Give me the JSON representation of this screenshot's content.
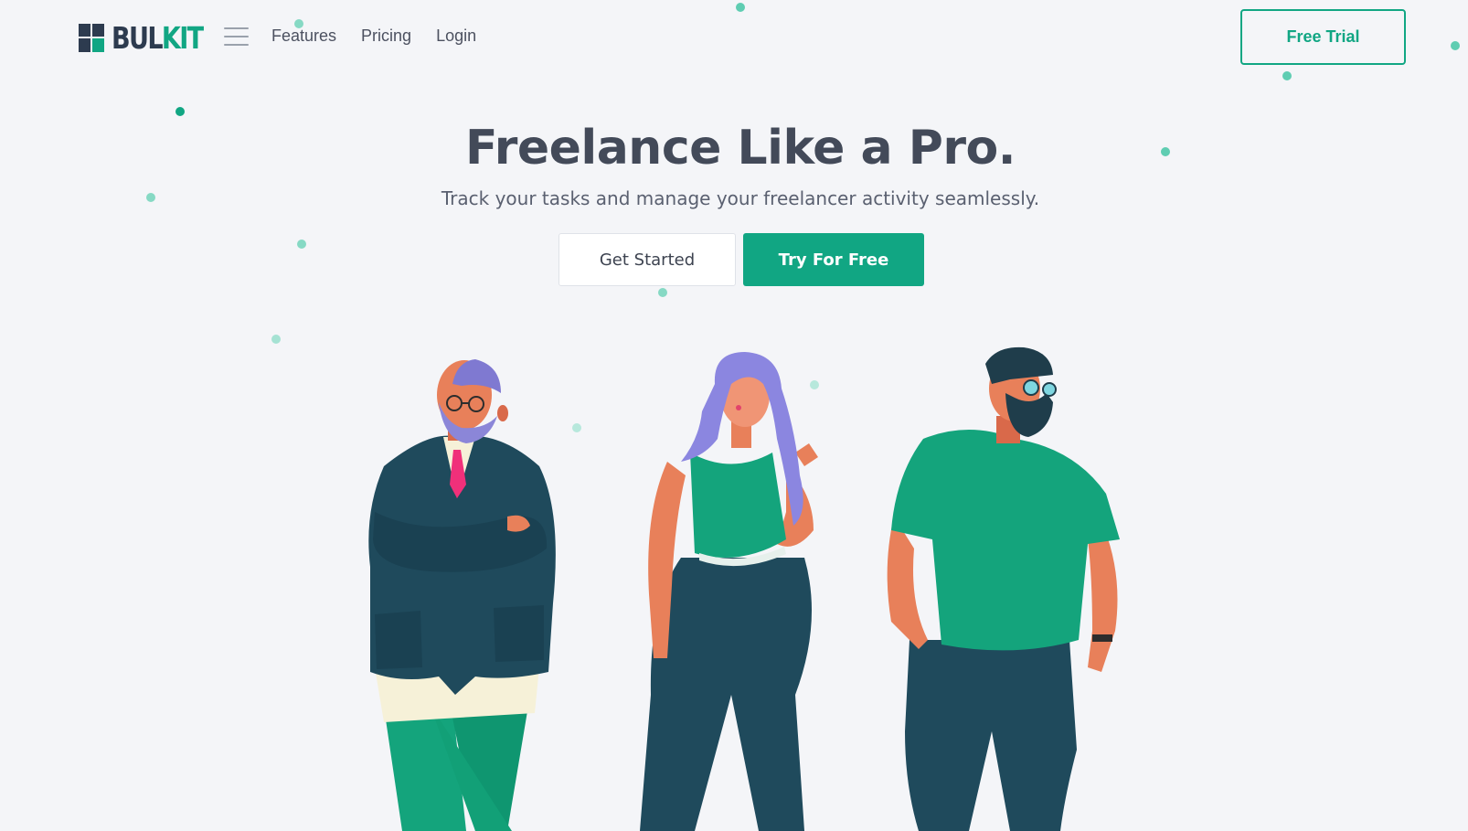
{
  "brand": {
    "name_part1": "BUL",
    "name_part2": "KIT",
    "accent_color": "#11a683",
    "dark_color": "#2d3b4f"
  },
  "nav": {
    "menu_icon": "hamburger-menu-icon",
    "links": [
      "Features",
      "Pricing",
      "Login"
    ],
    "cta_label": "Free Trial"
  },
  "hero": {
    "title": "Freelance Like a Pro.",
    "subtitle": "Track your tasks and manage your freelancer activity seamlessly.",
    "primary_button": "Get Started",
    "secondary_button": "Try For Free"
  },
  "illustration": {
    "people": [
      "businessman",
      "woman",
      "bearded-man"
    ]
  },
  "colors": {
    "background": "#f4f5f8",
    "dots": "#7fd6c1",
    "navy": "#1f4a5c",
    "green": "#11a683",
    "skin": "#e8805a"
  }
}
